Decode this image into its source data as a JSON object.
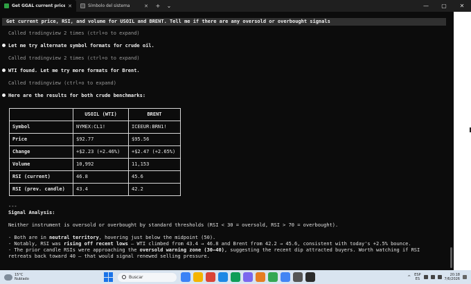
{
  "tabs": [
    {
      "title": "Get GGAL current price an",
      "icon_color": "#2ea043",
      "active": true
    },
    {
      "title": "Símbolo del sistema",
      "icon_color": "#4a4a4a",
      "active": false
    }
  ],
  "tabbar": {
    "new_tab": "+",
    "dropdown": "⌄"
  },
  "window_controls": {
    "minimize": "—",
    "maximize": "▢",
    "close": "✕"
  },
  "terminal": {
    "prompt": "Get current price, RSI, and volume for USOIL and BRENT. Tell me if there are any oversold or overbought signals",
    "called_1": "Called tradingview 2 times (ctrl+o to expand)",
    "msg_1": "Let me try alternate symbol formats for crude oil.",
    "called_2": "Called tradingview 2 times (ctrl+o to expand)",
    "msg_2": "WTI found. Let me try more formats for Brent.",
    "called_3": "Called tradingview (ctrl+o to expand)",
    "msg_3": "Here are the results for both crude benchmarks:",
    "table": {
      "headers": [
        "",
        "USOIL (WTI)",
        "BRENT"
      ],
      "rows": [
        [
          "Symbol",
          "NYMEX:CL1!",
          "ICEEUR:BRN1!"
        ],
        [
          "Price",
          "$92.77",
          "$95.56"
        ],
        [
          "Change",
          "+$2.23 (+2.46%)",
          "+$2.47 (+2.65%)"
        ],
        [
          "Volume",
          "10,992",
          "11,153"
        ],
        [
          "RSI (current)",
          "46.8",
          "45.6"
        ],
        [
          "RSI (prev. candle)",
          "43.4",
          "42.2"
        ]
      ]
    },
    "separator": "---",
    "analysis_heading": "Signal Analysis:",
    "analysis_summary": "Neither instrument is oversold or overbought by standard thresholds (RSI < 30 = oversold, RSI > 70 = overbought).",
    "b1_pre": "- Both are in ",
    "b1_bold": "neutral territory",
    "b1_post": ", hovering just below the midpoint (50).",
    "b2_pre": "- Notably, RSI was ",
    "b2_bold": "rising off recent lows",
    "b2_post": " — WTI climbed from 43.4 → 46.8 and Brent from 42.2 → 45.6, consistent with today's +2.5% bounce.",
    "b3_pre": "- The prior candle RSIs were approaching the ",
    "b3_bold": "oversold warning zone (30–40)",
    "b3_post": ", suggesting the recent dip attracted buyers. Worth watching if RSI retreats back toward 40 — that would signal renewed selling pressure."
  },
  "taskbar": {
    "weather_temp": "15°C",
    "weather_desc": "Nublado",
    "search_placeholder": "Buscar",
    "lang_top": "ESP",
    "lang_bottom": "ES",
    "time": "20:18",
    "date": "7/6/2026",
    "app_colors": [
      "#3b82f6",
      "#f4b400",
      "#db4437",
      "#1e88e5",
      "#0f9d58",
      "#7b68ee",
      "#e67e22",
      "#34a853",
      "#4285f4",
      "#555555",
      "#2b2b2b"
    ]
  }
}
